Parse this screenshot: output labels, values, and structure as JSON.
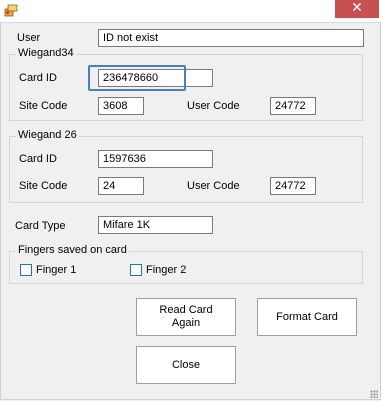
{
  "window": {
    "close_glyph": "✕"
  },
  "user": {
    "label": "User",
    "value": "ID not exist"
  },
  "wiegand34": {
    "title": "Wiegand34",
    "card_id_label": "Card ID",
    "card_id": "236478660",
    "site_code_label": "Site Code",
    "site_code": "3608",
    "user_code_label": "User Code",
    "user_code": "24772"
  },
  "wiegand26": {
    "title": "Wiegand 26",
    "card_id_label": "Card ID",
    "card_id": "1597636",
    "site_code_label": "Site Code",
    "site_code": "24",
    "user_code_label": "User Code",
    "user_code": "24772"
  },
  "card_type": {
    "label": "Card Type",
    "value": "Mifare 1K"
  },
  "fingers": {
    "title": "Fingers saved on card",
    "finger1_label": "Finger 1",
    "finger1_checked": false,
    "finger2_label": "Finger 2",
    "finger2_checked": false
  },
  "buttons": {
    "read_again_line1": "Read Card",
    "read_again_line2": "Again",
    "format": "Format Card",
    "close": "Close"
  },
  "colors": {
    "close_button": "#c75050",
    "focus_highlight": "#4a7cc9",
    "window_bg": "#f0f0f0"
  }
}
